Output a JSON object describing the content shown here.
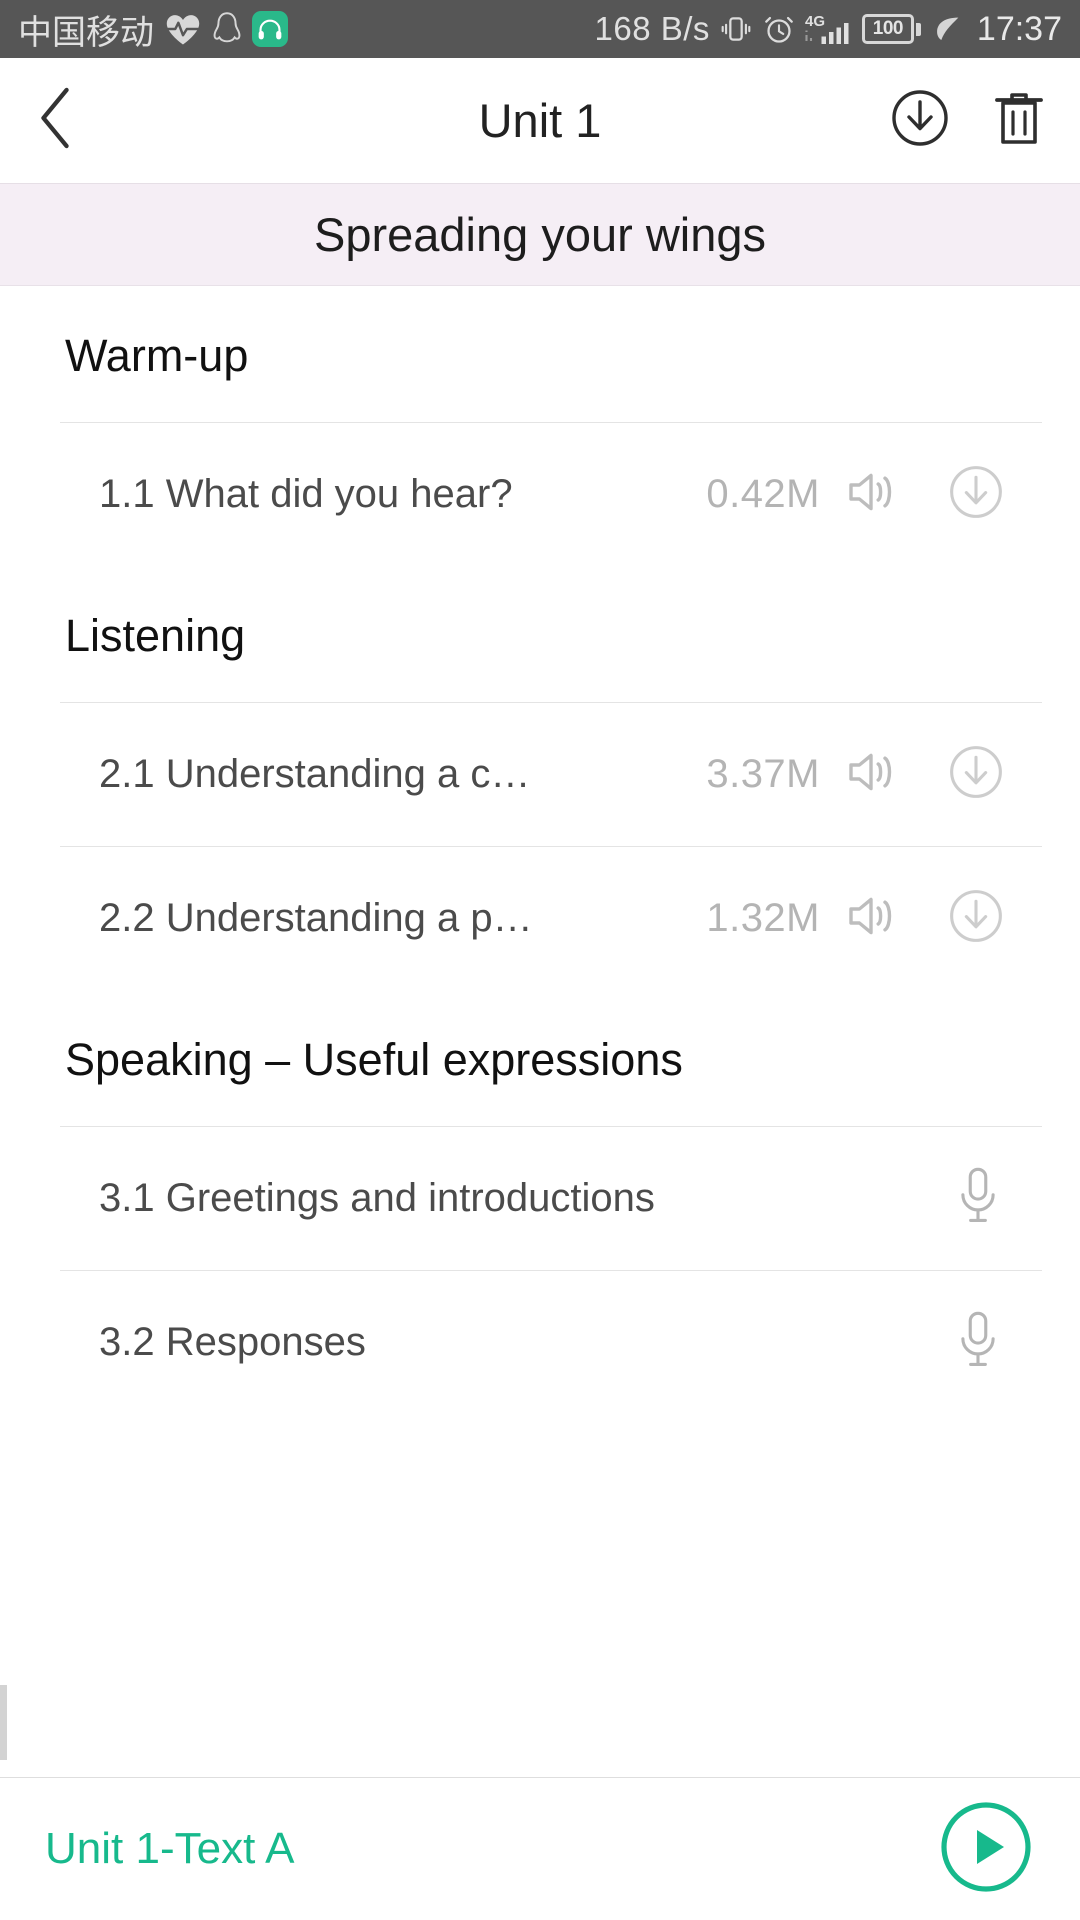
{
  "status_bar": {
    "carrier": "中国移动",
    "icons_left": [
      "heart-rate-icon",
      "qq-penguin-icon",
      "headphones-app-icon"
    ],
    "network_speed": "168 B/s",
    "icons_right": [
      "vibrate-icon",
      "alarm-clock-icon",
      "signal-4g-icon",
      "battery-icon",
      "power-saving-leaf-icon"
    ],
    "battery_level": "100",
    "time": "17:37",
    "background_color": "#565656"
  },
  "nav_bar": {
    "back_icon": "chevron-left-icon",
    "title": "Unit 1",
    "download_icon": "download-circle-icon",
    "delete_icon": "trash-icon"
  },
  "banner": {
    "title": "Spreading your wings",
    "background_color": "#f5eef5"
  },
  "sections": [
    {
      "header": "Warm-up",
      "tracks": [
        {
          "title": "1.1 What did you hear?",
          "size": "0.42M",
          "icons": [
            "speaker-icon",
            "download-circle-icon"
          ]
        }
      ]
    },
    {
      "header": "Listening",
      "tracks": [
        {
          "title": "2.1 Understanding a c…",
          "size": "3.37M",
          "icons": [
            "speaker-icon",
            "download-circle-icon"
          ]
        },
        {
          "title": "2.2 Understanding a p…",
          "size": "1.32M",
          "icons": [
            "speaker-icon",
            "download-circle-icon"
          ]
        }
      ]
    },
    {
      "header": "Speaking – Useful expressions",
      "tracks": [
        {
          "title": "3.1 Greetings and introductions",
          "size": "",
          "icons": [
            "microphone-icon"
          ]
        },
        {
          "title": "3.2 Responses",
          "size": "",
          "icons": [
            "microphone-icon"
          ]
        }
      ]
    }
  ],
  "player": {
    "title": "Unit 1-Text A",
    "play_icon": "play-circle-icon",
    "accent_color": "#17b98c"
  }
}
